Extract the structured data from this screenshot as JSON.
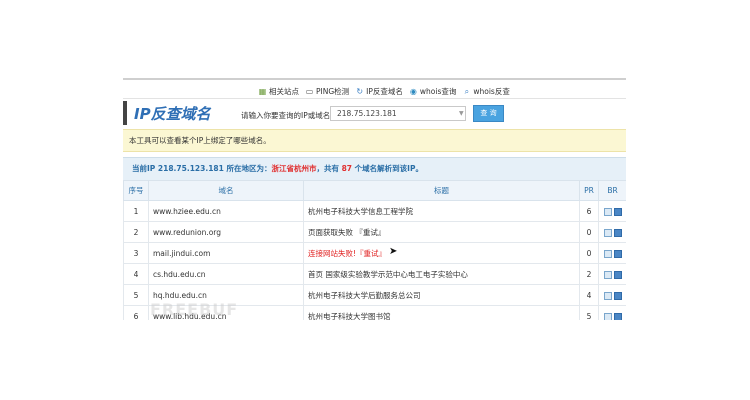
{
  "nav": {
    "items": [
      {
        "label": "相关站点",
        "icon": "grid-icon"
      },
      {
        "label": "PING检测",
        "icon": "monitor-icon"
      },
      {
        "label": "IP反查域名",
        "icon": "refresh-icon"
      },
      {
        "label": "whois查询",
        "icon": "globe-icon"
      },
      {
        "label": "whois反查",
        "icon": "search-icon"
      }
    ]
  },
  "header": {
    "title": "IP反查域名",
    "search_label": "请输入你要查询的IP或域名：",
    "search_value": "218.75.123.181",
    "search_button": "查 询"
  },
  "notice": "本工具可以查看某个IP上绑定了哪些域名。",
  "summary": {
    "p1": "当前IP 218.75.123.181 所在地区为：",
    "region": "浙江省杭州市",
    "p2": "，共有",
    "count": "87",
    "p3": "个域名解析到该IP。"
  },
  "table": {
    "headers": {
      "no": "序号",
      "domain": "域名",
      "title": "标题",
      "pr": "PR",
      "br": "BR"
    },
    "rows": [
      {
        "no": "1",
        "domain": "www.hziee.edu.cn",
        "title": "杭州电子科技大学信息工程学院",
        "pr": "6",
        "error": false
      },
      {
        "no": "2",
        "domain": "www.redunion.org",
        "title": "页面获取失败 『重试』",
        "pr": "0",
        "error": false
      },
      {
        "no": "3",
        "domain": "mail.jindui.com",
        "title": "连接网站失败!『重试』",
        "pr": "0",
        "error": true
      },
      {
        "no": "4",
        "domain": "cs.hdu.edu.cn",
        "title": "首页 国家级实验教学示范中心电工电子实验中心",
        "pr": "2",
        "error": false
      },
      {
        "no": "5",
        "domain": "hq.hdu.edu.cn",
        "title": "杭州电子科技大学后勤服务总公司",
        "pr": "4",
        "error": false
      },
      {
        "no": "6",
        "domain": "www.lib.hdu.edu.cn",
        "title": "杭州电子科技大学图书馆",
        "pr": "5",
        "error": false
      }
    ]
  },
  "watermark": "FREEBUF",
  "colors": {
    "accent": "#2f6fb5",
    "domain_green": "#2e8b2e",
    "error_red": "#e02020",
    "notice_bg": "#fbf7d3"
  }
}
